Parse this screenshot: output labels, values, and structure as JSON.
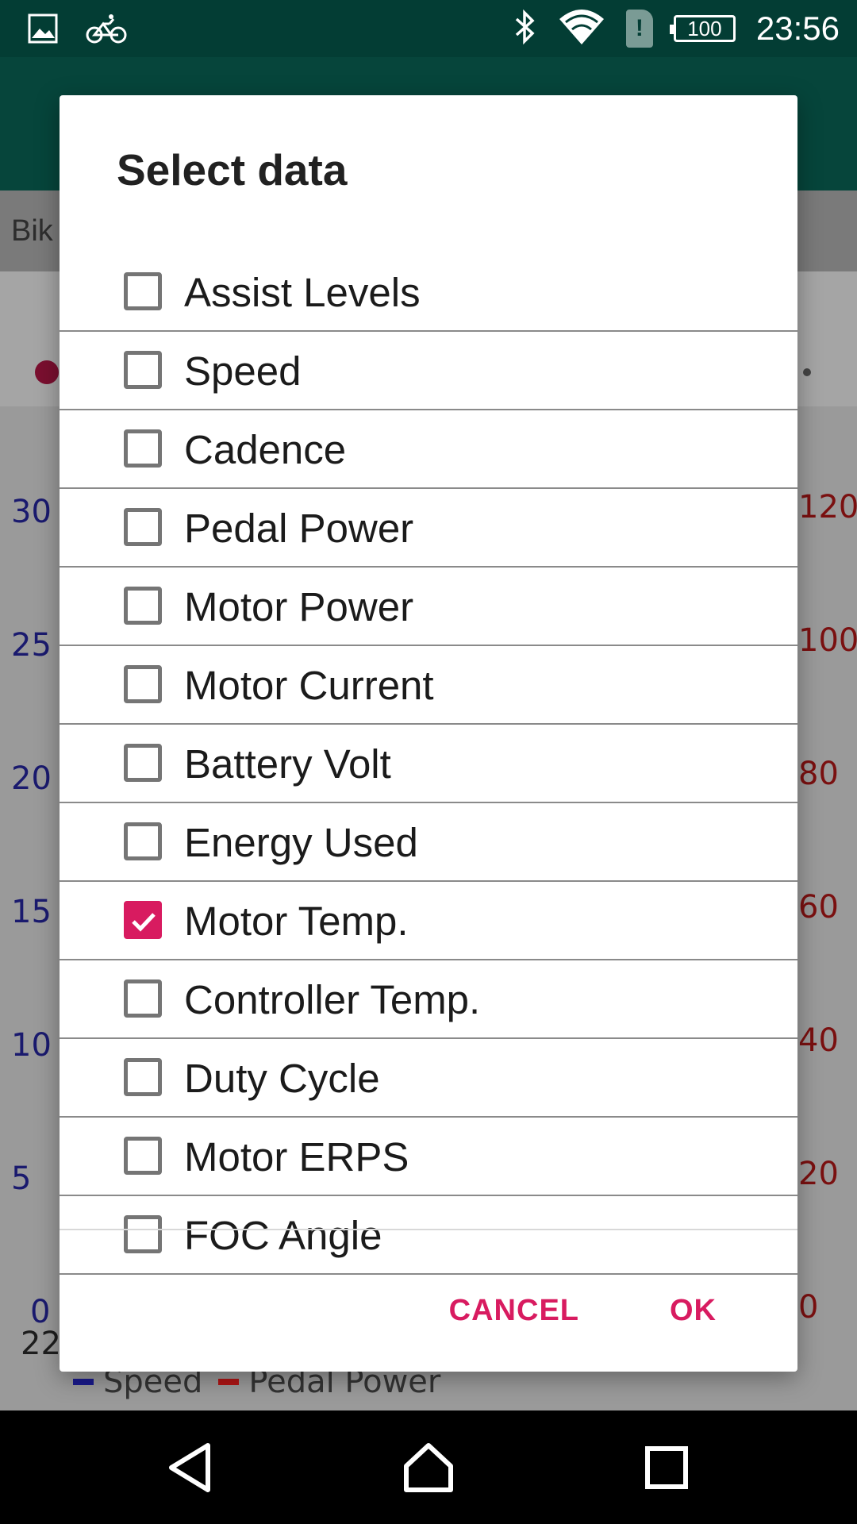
{
  "status_bar": {
    "left_icons": [
      "image-icon",
      "bicycle-icon"
    ],
    "right_icons": [
      "bluetooth-icon",
      "wifi-icon",
      "sim-alert-icon"
    ],
    "sim_alert": "!",
    "battery": "100",
    "time": "23:56"
  },
  "background": {
    "tab_label": "Bik",
    "left_axis": [
      "30",
      "25",
      "20",
      "15",
      "10",
      "5",
      "0"
    ],
    "right_axis": [
      "120",
      "100",
      "80",
      "60",
      "40",
      "20",
      "0"
    ],
    "x_tick": "22",
    "legend": [
      {
        "name": "Speed",
        "color": "#1a1a8c"
      },
      {
        "name": "Pedal Power",
        "color": "#b01515"
      }
    ]
  },
  "dialog": {
    "title": "Select data",
    "options": [
      {
        "label": "Assist Levels",
        "checked": false
      },
      {
        "label": "Speed",
        "checked": false
      },
      {
        "label": "Cadence",
        "checked": false
      },
      {
        "label": "Pedal Power",
        "checked": false
      },
      {
        "label": "Motor Power",
        "checked": false
      },
      {
        "label": "Motor Current",
        "checked": false
      },
      {
        "label": "Battery Volt",
        "checked": false
      },
      {
        "label": "Energy Used",
        "checked": false
      },
      {
        "label": "Motor Temp.",
        "checked": true
      },
      {
        "label": "Controller Temp.",
        "checked": false
      },
      {
        "label": "Duty Cycle",
        "checked": false
      },
      {
        "label": "Motor ERPS",
        "checked": false
      },
      {
        "label": "FOC Angle",
        "checked": false
      }
    ],
    "cancel_label": "CANCEL",
    "ok_label": "OK",
    "accent_color": "#d81b60"
  },
  "nav_bar": {
    "buttons": [
      "back-icon",
      "home-icon",
      "recents-icon"
    ]
  }
}
